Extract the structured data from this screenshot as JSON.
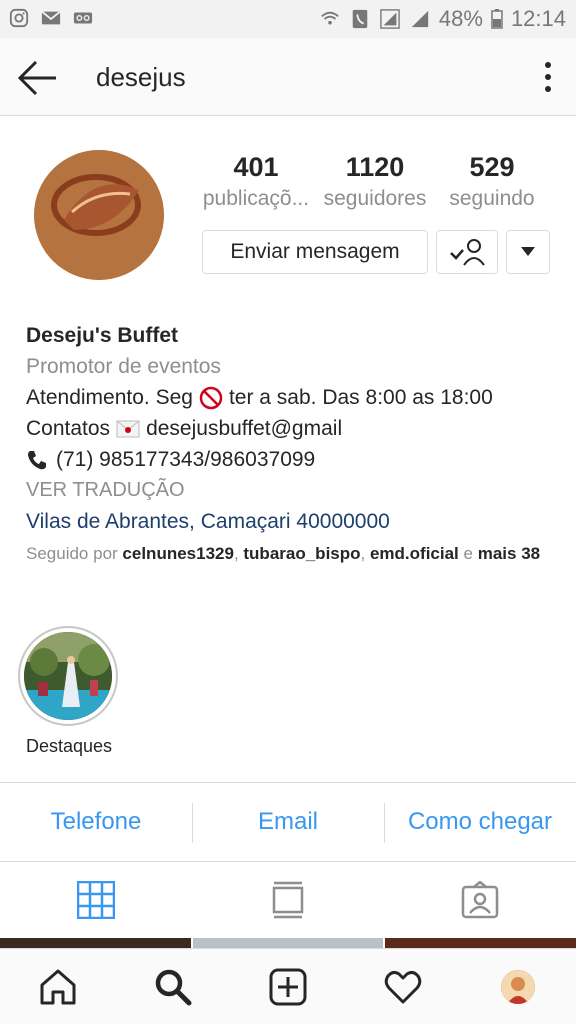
{
  "status_bar": {
    "battery": "48%",
    "time": "12:14",
    "left_icons": [
      "instagram-icon",
      "email-icon",
      "voicemail-icon"
    ],
    "right_icons": [
      "wifi-icon",
      "phone-call-icon",
      "signal-icon",
      "signal-icon",
      "battery-icon"
    ]
  },
  "header": {
    "username": "desejus",
    "back_icon": "arrow-left-icon",
    "menu_icon": "kebab-menu-icon"
  },
  "profile": {
    "avatar_text": "Deseju's buffet",
    "stats": [
      {
        "value": "401",
        "label": "publicaçõ..."
      },
      {
        "value": "1120",
        "label": "seguidores"
      },
      {
        "value": "529",
        "label": "seguindo"
      }
    ],
    "message_button": "Enviar mensagem"
  },
  "bio": {
    "name": "Deseju's Buffet",
    "category": "Promotor de eventos",
    "hours_before": "Atendimento. Seg",
    "hours_after": "ter a sab. Das 8:00 as 18:00",
    "contacts_before": "Contatos",
    "contacts_after": "desejusbuffet@gmail",
    "phone": "(71) 985177343/986037099",
    "translate": "VER TRADUÇÃO",
    "location": "Vilas de Abrantes, Camaçari 40000000",
    "followed_by_prefix": "Seguido por",
    "followed_by_users": [
      "celnunes1329",
      "tubarao_bispo",
      "emd.oficial"
    ],
    "followed_by_and": "e",
    "followed_by_more": "mais 38"
  },
  "highlights": [
    {
      "label": "Destaques"
    }
  ],
  "contact_buttons": [
    "Telefone",
    "Email",
    "Como chegar"
  ],
  "colors": {
    "link_blue": "#3897f0",
    "location_blue": "#1d3f6e",
    "muted": "#8e8e8e",
    "text": "#262626",
    "divider": "#dbdbdb"
  },
  "tabs": [
    "grid-icon",
    "feed-icon",
    "tagged-icon"
  ],
  "bottom_nav": [
    "home-icon",
    "search-icon",
    "add-icon",
    "heart-icon",
    "profile-avatar"
  ]
}
